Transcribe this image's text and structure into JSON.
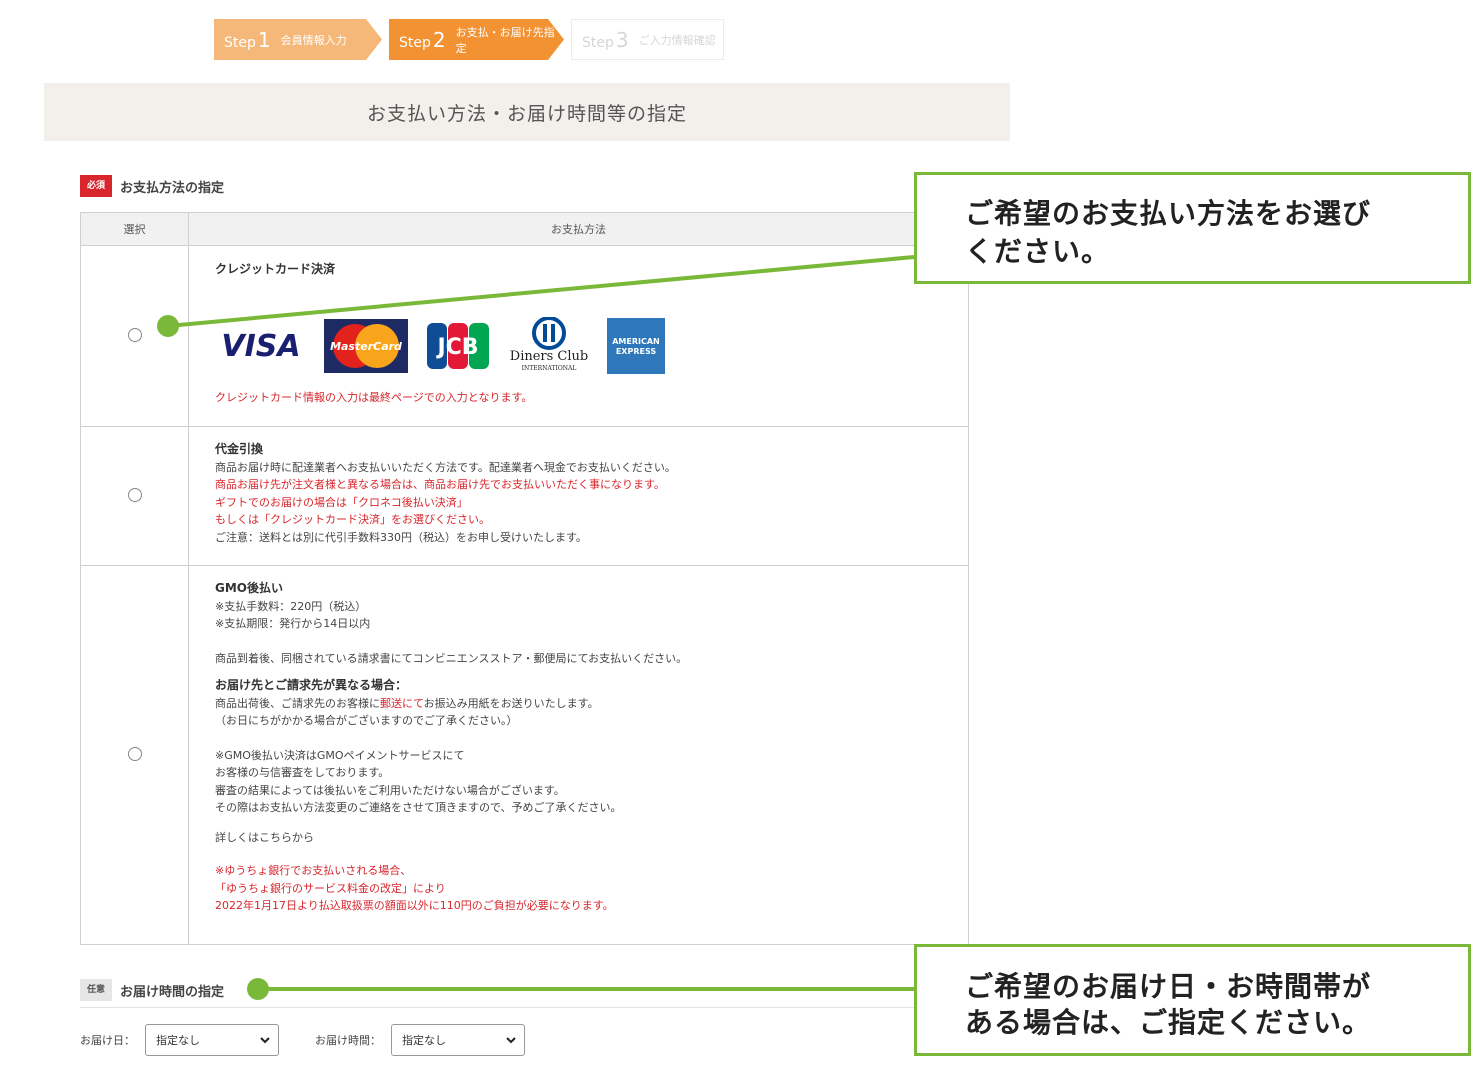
{
  "steps": [
    {
      "word": "Step",
      "num": "1",
      "label": "会員情報入力"
    },
    {
      "word": "Step",
      "num": "2",
      "label": "お支払・お届け先指定"
    },
    {
      "word": "Step",
      "num": "3",
      "label": "ご入力情報確認"
    }
  ],
  "page_title": "お支払い方法・お届け時間等の指定",
  "payment_section": {
    "badge": "必須",
    "title": "お支払方法の指定",
    "col_select": "選択",
    "col_method": "お支払方法"
  },
  "credit": {
    "title": "クレジットカード決済",
    "note": "クレジットカード情報の入力は最終ページでの入力となります。",
    "card_logos": [
      "VISA",
      "MasterCard",
      "JCB",
      "Diners Club",
      "INTERNATIONAL",
      "AMERICAN",
      "EXPRESS"
    ]
  },
  "cod": {
    "title": "代金引換",
    "line1": "商品お届け時に配達業者へお支払いいただく方法です。配達業者へ現金でお支払いください。",
    "red1": "商品お届け先が注文者様と異なる場合は、商品お届け先でお支払いいただく事になります。",
    "red2": "ギフトでのお届けの場合は「クロネコ後払い決済」",
    "red3": "もしくは「クレジットカード決済」をお選びください。",
    "line2": "ご注意：送料とは別に代引手数料330円（税込）をお申し受けいたします。"
  },
  "gmo": {
    "title": "GMO後払い",
    "fee": "※支払手数料：220円（税込）",
    "deadline": "※支払期限：発行から14日以内",
    "desc": "商品到着後、同梱されている請求書にてコンビニエンスストア・郵便局にてお支払いください。",
    "diff_title": "お届け先とご請求先が異なる場合：",
    "diff_pre": "商品出荷後、ご請求先のお客様に",
    "diff_red": "郵送にて",
    "diff_post": "お振込み用紙をお送りいたします。",
    "diff_note": "（お日にちがかかる場合がございますのでご了承ください。）",
    "s1": "※GMO後払い決済はGMOペイメントサービスにて",
    "s2": "お客様の与信審査をしております。",
    "s3": "審査の結果によっては後払いをご利用いただけない場合がございます。",
    "s4": "その際はお支払い方法変更のご連絡をさせて頂きますので、予めご了承ください。",
    "detail_link": "詳しくはこちらから",
    "r1": "※ゆうちょ銀行でお支払いされる場合、",
    "r2": "「ゆうちょ銀行のサービス料金の改定」により",
    "r3": "2022年1月17日より払込取扱票の額面以外に110円のご負担が必要になります。"
  },
  "delivery_section": {
    "badge": "任意",
    "title": "お届け時間の指定",
    "date_label": "お届け日：",
    "date_value": "指定なし",
    "time_label": "お届け時間：",
    "time_value": "指定なし"
  },
  "callouts": {
    "payment_line1": "ご希望のお支払い方法をお選び",
    "payment_line2": "ください。",
    "delivery_line1": "ご希望のお届け日・お時間帯が",
    "delivery_line2": "ある場合は、ご指定ください。"
  },
  "colors": {
    "step_done": "#f6b878",
    "step_active": "#f29233",
    "required_red": "#d9262c",
    "callout_green": "#7ab83a"
  }
}
